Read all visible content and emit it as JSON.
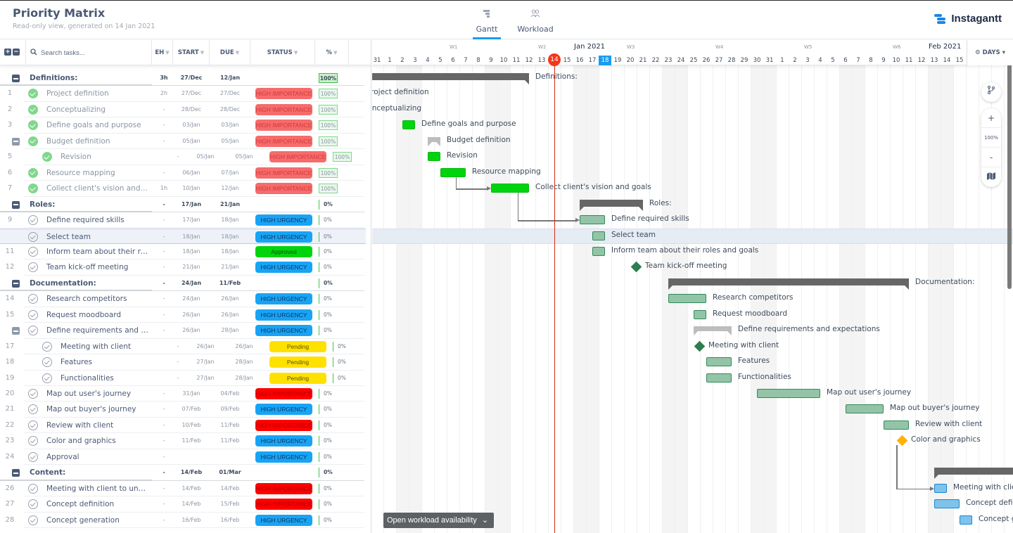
{
  "header": {
    "title": "Priority Matrix",
    "subtitle": "Read-only view, generated on 14 Jan 2021",
    "views": [
      {
        "label": "Gantt",
        "icon": "gantt-icon",
        "active": true
      },
      {
        "label": "Workload",
        "icon": "users-icon",
        "active": false
      }
    ],
    "brand": "Instagantt"
  },
  "table": {
    "search_placeholder": "Search tasks...",
    "columns": {
      "eh": "EH",
      "start": "START",
      "due": "DUE",
      "status": "STATUS",
      "pct": "%"
    },
    "rows": [
      {
        "type": "group",
        "name": "Definitions:",
        "eh": "3h",
        "start": "27/Dec",
        "due": "12/Jan",
        "status": "",
        "pct": "100%"
      },
      {
        "type": "task",
        "num": "1",
        "name": "Project definition",
        "done": true,
        "eh": "2h",
        "start": "27/Dec",
        "due": "27/Dec",
        "status": "HIGH IMPORTANCE",
        "pct": "100%"
      },
      {
        "type": "task",
        "num": "2",
        "name": "Conceptualizing",
        "done": true,
        "eh": "-",
        "start": "28/Dec",
        "due": "28/Dec",
        "status": "HIGH IMPORTANCE",
        "pct": "100%"
      },
      {
        "type": "task",
        "num": "3",
        "name": "Define goals and purpose",
        "done": true,
        "eh": "-",
        "start": "03/Jan",
        "due": "03/Jan",
        "status": "HIGH IMPORTANCE",
        "pct": "100%"
      },
      {
        "type": "task",
        "num": "",
        "name": "Budget definition",
        "done": true,
        "parent": true,
        "eh": "-",
        "start": "05/Jan",
        "due": "05/Jan",
        "status": "HIGH IMPORTANCE",
        "pct": "100%"
      },
      {
        "type": "subtask",
        "num": "5",
        "name": "Revision",
        "done": true,
        "eh": "-",
        "start": "05/Jan",
        "due": "05/Jan",
        "status": "HIGH IMPORTANCE",
        "pct": "100%"
      },
      {
        "type": "task",
        "num": "6",
        "name": "Resource mapping",
        "done": true,
        "eh": "-",
        "start": "06/Jan",
        "due": "07/Jan",
        "status": "HIGH IMPORTANCE",
        "pct": "100%"
      },
      {
        "type": "task",
        "num": "7",
        "name": "Collect client's vision and g...",
        "done": true,
        "eh": "1h",
        "start": "10/Jan",
        "due": "12/Jan",
        "status": "HIGH IMPORTANCE",
        "pct": "100%"
      },
      {
        "type": "group",
        "name": "Roles:",
        "eh": "-",
        "start": "17/Jan",
        "due": "21/Jan",
        "status": "",
        "pct": "0%"
      },
      {
        "type": "task",
        "num": "9",
        "name": "Define required skills",
        "done": false,
        "eh": "-",
        "start": "17/Jan",
        "due": "18/Jan",
        "status": "HIGH URGENCY",
        "pct": "0%"
      },
      {
        "type": "task",
        "num": "",
        "name": "Select team",
        "done": false,
        "selected": true,
        "eh": "-",
        "start": "18/Jan",
        "due": "18/Jan",
        "status": "HIGH URGENCY",
        "pct": "0%"
      },
      {
        "type": "task",
        "num": "11",
        "name": "Inform team about their rol...",
        "done": false,
        "eh": "-",
        "start": "18/Jan",
        "due": "18/Jan",
        "status": "Approved",
        "pct": "0%"
      },
      {
        "type": "task",
        "num": "12",
        "name": "Team kick-off meeting",
        "done": false,
        "eh": "-",
        "start": "21/Jan",
        "due": "21/Jan",
        "status": "HIGH URGENCY",
        "pct": "0%"
      },
      {
        "type": "group",
        "name": "Documentation:",
        "eh": "-",
        "start": "24/Jan",
        "due": "11/Feb",
        "status": "",
        "pct": "0%"
      },
      {
        "type": "task",
        "num": "14",
        "name": "Research competitors",
        "done": false,
        "eh": "-",
        "start": "24/Jan",
        "due": "26/Jan",
        "status": "HIGH URGENCY",
        "pct": "0%"
      },
      {
        "type": "task",
        "num": "15",
        "name": "Request moodboard",
        "done": false,
        "eh": "-",
        "start": "26/Jan",
        "due": "26/Jan",
        "status": "HIGH URGENCY",
        "pct": "0%"
      },
      {
        "type": "task",
        "num": "",
        "name": "Define requirements and e...",
        "done": false,
        "parent": true,
        "eh": "-",
        "start": "26/Jan",
        "due": "28/Jan",
        "status": "HIGH URGENCY",
        "pct": "0%"
      },
      {
        "type": "subtask",
        "num": "17",
        "name": "Meeting with client",
        "done": false,
        "eh": "-",
        "start": "26/Jan",
        "due": "26/Jan",
        "status": "Pending",
        "pct": "0%"
      },
      {
        "type": "subtask",
        "num": "18",
        "name": "Features",
        "done": false,
        "eh": "-",
        "start": "27/Jan",
        "due": "28/Jan",
        "status": "Pending",
        "pct": "0%"
      },
      {
        "type": "subtask",
        "num": "19",
        "name": "Functionalities",
        "done": false,
        "eh": "-",
        "start": "27/Jan",
        "due": "28/Jan",
        "status": "Pending",
        "pct": "0%"
      },
      {
        "type": "task",
        "num": "20",
        "name": "Map out user's journey",
        "done": false,
        "eh": "-",
        "start": "31/Jan",
        "due": "04/Feb",
        "status": "HIGH IMPORTANCE",
        "statusAlt": true,
        "pct": "0%"
      },
      {
        "type": "task",
        "num": "21",
        "name": "Map out buyer's journey",
        "done": false,
        "eh": "-",
        "start": "07/Feb",
        "due": "09/Feb",
        "status": "HIGH URGENCY",
        "pct": "0%"
      },
      {
        "type": "task",
        "num": "22",
        "name": "Review with client",
        "done": false,
        "eh": "-",
        "start": "10/Feb",
        "due": "11/Feb",
        "status": "HIGH IMPORTANCE",
        "statusAlt": true,
        "pct": "0%"
      },
      {
        "type": "task",
        "num": "23",
        "name": "Color and graphics",
        "done": false,
        "eh": "-",
        "start": "11/Feb",
        "due": "11/Feb",
        "status": "HIGH URGENCY",
        "pct": "0%"
      },
      {
        "type": "task",
        "num": "24",
        "name": "Approval",
        "done": false,
        "eh": "-",
        "start": "",
        "due": "",
        "status": "HIGH URGENCY",
        "pct": "0%"
      },
      {
        "type": "group",
        "name": "Content:",
        "eh": "-",
        "start": "14/Feb",
        "due": "01/Mar",
        "status": "",
        "pct": "0%"
      },
      {
        "type": "task",
        "num": "26",
        "name": "Meeting with client to unde...",
        "done": false,
        "eh": "-",
        "start": "14/Feb",
        "due": "14/Feb",
        "status": "HIGH IMPORTANCE",
        "statusAlt": true,
        "pct": "0%"
      },
      {
        "type": "task",
        "num": "27",
        "name": "Concept definition",
        "done": false,
        "eh": "-",
        "start": "14/Feb",
        "due": "15/Feb",
        "status": "HIGH IMPORTANCE",
        "statusAlt": true,
        "pct": "0%"
      },
      {
        "type": "task",
        "num": "28",
        "name": "Concept generation",
        "done": false,
        "eh": "-",
        "start": "16/Feb",
        "due": "16/Feb",
        "status": "HIGH URGENCY",
        "pct": "0%"
      }
    ]
  },
  "status_colors": {
    "HIGH IMPORTANCE": {
      "bg": "#ff0000",
      "fg": "#b00000"
    },
    "HIGH IMPORTANCE (done)": {
      "bg": "#f66b6b",
      "fg": "#d23a3a"
    },
    "HIGH URGENCY": {
      "bg": "#18a4f5",
      "fg": "#10315c"
    },
    "Approved": {
      "bg": "#00d40c",
      "fg": "#0f4d13"
    },
    "Pending": {
      "bg": "#ffe100",
      "fg": "#5c5000"
    }
  },
  "timeline": {
    "weeks": [
      {
        "label": "W1",
        "day": 6
      },
      {
        "label": "W2",
        "day": 13
      },
      {
        "label": "W3",
        "day": 20
      },
      {
        "label": "W4",
        "day": 27
      },
      {
        "label": "W5",
        "day": 34
      },
      {
        "label": "W6",
        "day": 41
      }
    ],
    "months": [
      {
        "label": "Jan 2021",
        "day": 16
      },
      {
        "label": "Feb 2021",
        "day": 44
      }
    ],
    "days": [
      "31",
      "1",
      "2",
      "3",
      "4",
      "5",
      "6",
      "7",
      "8",
      "9",
      "10",
      "11",
      "12",
      "13",
      "14",
      "15",
      "16",
      "17",
      "18",
      "19",
      "20",
      "21",
      "22",
      "23",
      "24",
      "25",
      "26",
      "27",
      "28",
      "29",
      "30",
      "31",
      "1",
      "2",
      "3",
      "4",
      "5",
      "6",
      "7",
      "8",
      "9",
      "10",
      "11",
      "12",
      "13",
      "14",
      "15"
    ],
    "today_index": 14,
    "highlight_index": 18,
    "scale_label": "DAYS",
    "zoom_level": "100%",
    "workload_button": "Open workload availability"
  },
  "gantt_items": [
    {
      "row": 0,
      "kind": "group",
      "start": -14,
      "end": 12.5,
      "label": "Definitions:"
    },
    {
      "row": 1,
      "kind": "label-only",
      "label": "Project definition"
    },
    {
      "row": 2,
      "kind": "label-only",
      "label": "Conceptualizing"
    },
    {
      "row": 3,
      "kind": "bar",
      "color": "green",
      "start": 2.5,
      "end": 3.5,
      "label": "Define goals and purpose"
    },
    {
      "row": 4,
      "kind": "subgroup",
      "start": 4.5,
      "end": 5.5,
      "label": "Budget definition"
    },
    {
      "row": 5,
      "kind": "bar",
      "color": "green",
      "start": 4.5,
      "end": 5.5,
      "label": "Revision"
    },
    {
      "row": 6,
      "kind": "bar",
      "color": "green",
      "start": 5.5,
      "end": 7.5,
      "label": "Resource mapping"
    },
    {
      "row": 7,
      "kind": "bar",
      "color": "green",
      "start": 9.5,
      "end": 12.5,
      "label": "Collect client's vision and goals"
    },
    {
      "row": 8,
      "kind": "group",
      "start": 16.5,
      "end": 21.5,
      "label": "Roles:"
    },
    {
      "row": 9,
      "kind": "bar",
      "color": "sage",
      "start": 16.5,
      "end": 18.5,
      "label": "Define required skills"
    },
    {
      "row": 10,
      "kind": "bar",
      "color": "sage",
      "start": 17.5,
      "end": 18.5,
      "label": "Select team"
    },
    {
      "row": 11,
      "kind": "bar",
      "color": "sage",
      "start": 17.5,
      "end": 18.5,
      "label": "Inform team about their roles and goals"
    },
    {
      "row": 12,
      "kind": "milestone",
      "color": "#2e7d4f",
      "start": 20.5,
      "label": "Team kick-off meeting"
    },
    {
      "row": 13,
      "kind": "group",
      "start": 23.5,
      "end": 42.5,
      "label": "Documentation:"
    },
    {
      "row": 14,
      "kind": "bar",
      "color": "sage",
      "start": 23.5,
      "end": 26.5,
      "label": "Research competitors"
    },
    {
      "row": 15,
      "kind": "bar",
      "color": "sage",
      "start": 25.5,
      "end": 26.5,
      "label": "Request moodboard"
    },
    {
      "row": 16,
      "kind": "subgroup",
      "start": 25.5,
      "end": 28.5,
      "label": "Define requirements and expectations"
    },
    {
      "row": 17,
      "kind": "milestone",
      "color": "#2e7d4f",
      "start": 25.5,
      "label": "Meeting with client"
    },
    {
      "row": 18,
      "kind": "bar",
      "color": "sage",
      "start": 26.5,
      "end": 28.5,
      "label": "Features"
    },
    {
      "row": 19,
      "kind": "bar",
      "color": "sage",
      "start": 26.5,
      "end": 28.5,
      "label": "Functionalities"
    },
    {
      "row": 20,
      "kind": "bar",
      "color": "sage",
      "start": 30.5,
      "end": 35.5,
      "label": "Map out user's journey"
    },
    {
      "row": 21,
      "kind": "bar",
      "color": "sage",
      "start": 37.5,
      "end": 40.5,
      "label": "Map out buyer's journey"
    },
    {
      "row": 22,
      "kind": "bar",
      "color": "sage",
      "start": 40.5,
      "end": 42.5,
      "label": "Review with client"
    },
    {
      "row": 23,
      "kind": "milestone",
      "color": "#ffb300",
      "start": 41.5,
      "label": "Color and graphics"
    },
    {
      "row": 25,
      "kind": "group",
      "start": 44.5,
      "end": 60,
      "label": "Content:"
    },
    {
      "row": 26,
      "kind": "bar",
      "color": "blue",
      "start": 44.5,
      "end": 45.5,
      "label": "Meeting with client to understand"
    },
    {
      "row": 27,
      "kind": "bar",
      "color": "blue",
      "start": 44.5,
      "end": 46.5,
      "label": "Concept definition"
    },
    {
      "row": 28,
      "kind": "bar",
      "color": "blue",
      "start": 46.5,
      "end": 47.5,
      "label": "Concept generation"
    }
  ],
  "dependencies": [
    {
      "from_row": 6,
      "from_day": 6.7,
      "to_row": 7,
      "to_day": 9.5
    },
    {
      "from_row": 7,
      "from_day": 11.6,
      "to_row": 9,
      "to_day": 16.5
    },
    {
      "from_row": 23,
      "from_day": 41.5,
      "to_row": 26,
      "to_day": 44.5
    }
  ]
}
